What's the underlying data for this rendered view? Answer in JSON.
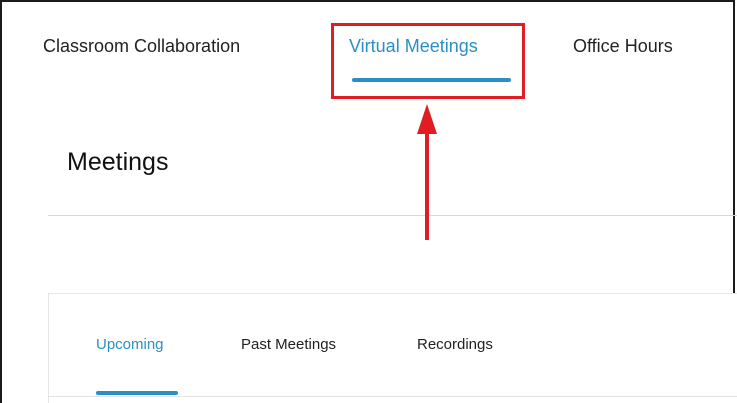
{
  "top_tabs": [
    {
      "label": "Classroom Collaboration",
      "active": false
    },
    {
      "label": "Virtual Meetings",
      "active": true
    },
    {
      "label": "Office Hours",
      "active": false
    }
  ],
  "page_title": "Meetings",
  "sub_tabs": [
    {
      "label": "Upcoming",
      "active": true
    },
    {
      "label": "Past Meetings",
      "active": false
    },
    {
      "label": "Recordings",
      "active": false
    }
  ],
  "colors": {
    "accent": "#2a8fc4",
    "annotation": "#e11c22"
  }
}
